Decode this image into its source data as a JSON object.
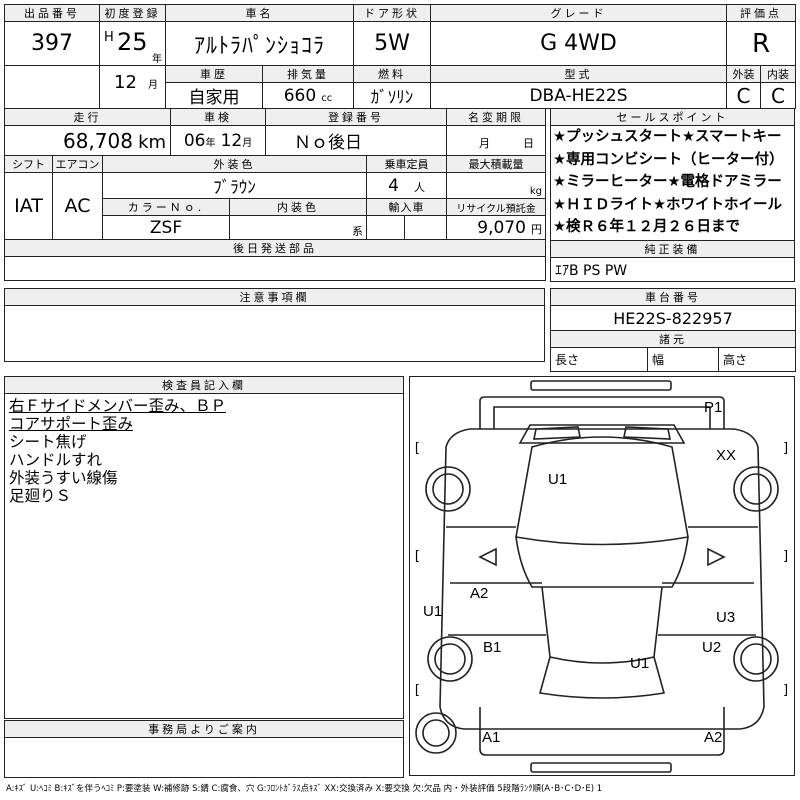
{
  "header": {
    "lot_label": "出品番号",
    "lot_number": "397",
    "first_reg_label": "初度登録",
    "era": "H",
    "year": "25",
    "year_unit": "年",
    "month": "12",
    "month_unit": "月",
    "car_name_label": "車名",
    "car_name": "ｱﾙﾄﾗﾊﾟﾝｼｮｺﾗ",
    "door_label": "ドア形状",
    "door": "5W",
    "grade_label": "グレード",
    "grade": "G 4WD",
    "score_label": "評価点",
    "score": "R",
    "history_label": "車歴",
    "history": "自家用",
    "displacement_label": "排気量",
    "displacement": "660",
    "displacement_unit": "cc",
    "fuel_label": "燃料",
    "fuel": "ｶﾞｿﾘﾝ",
    "model_label": "型式",
    "model": "DBA-HE22S",
    "exterior_label": "外装",
    "exterior": "C",
    "interior_label": "内装",
    "interior": "C"
  },
  "row2": {
    "mileage_label": "走行",
    "mileage": "68,708",
    "mileage_unit": "km",
    "inspection_label": "車検",
    "inspection_year": "06",
    "inspection_year_unit": "年",
    "inspection_month": "12",
    "inspection_month_unit": "月",
    "reg_number_label": "登録番号",
    "reg_number": "Ｎｏ後日",
    "name_change_label": "名変期限",
    "name_change_month": "月",
    "name_change_day": "日",
    "shift_label": "シフト",
    "shift": "IAT",
    "aircon_label": "エアコン",
    "aircon": "AC",
    "ext_color_label": "外装色",
    "ext_color": "ﾌﾞﾗｳﾝ",
    "capacity_label": "乗車定員",
    "capacity": "4",
    "capacity_unit": "人",
    "max_load_label": "最大積載量",
    "max_load_unit": "kg",
    "color_no_label": "カラーＮｏ.",
    "color_no": "ZSF",
    "int_color_label": "内装色",
    "int_color_unit": "系",
    "import_label": "輸入車",
    "recycle_label": "リサイクル預託金",
    "recycle": "9,070",
    "recycle_unit": "円",
    "later_parts_label": "後日発送部品"
  },
  "sales_points": {
    "label": "セールスポイント",
    "lines": [
      "★プッシュスタート★スマートキー",
      "★専用コンビシート（ヒーター付）",
      "★ミラーヒーター★電格ドアミラー",
      "★ＨＩＤライト★ホワイトホイール",
      "★検Ｒ６年１２月２６日まで"
    ]
  },
  "equipment": {
    "label": "純正装備",
    "value": "ｴｱB PS PW"
  },
  "notes": {
    "label": "注意事項欄"
  },
  "chassis": {
    "label": "車台番号",
    "value": "HE22S-822957"
  },
  "dimensions": {
    "label": "諸元",
    "length": "長さ",
    "width": "幅",
    "height": "高さ"
  },
  "inspector": {
    "label": "検査員記入欄",
    "lines": [
      "右Ｆサイドメンバー歪み、ＢＰ",
      "コアサポート歪み",
      "シート焦げ",
      "ハンドルすれ",
      "外装うすい線傷",
      "足廻りＳ"
    ]
  },
  "office": {
    "label": "事務局よりご案内"
  },
  "diagram": {
    "marks": {
      "p1": "P1",
      "xx": "XX",
      "u1_hood": "U1",
      "a2_left": "A2",
      "u1_left": "U1",
      "b1": "B1",
      "u3": "U3",
      "u2": "U2",
      "u1_rear": "U1",
      "a1": "A1",
      "a2_bottom": "A2"
    },
    "brackets": [
      "[",
      "]",
      "[",
      "]",
      "[",
      "]"
    ]
  },
  "legend": "A:ｷｽﾞ U:ﾍｺﾐ B:ｷｽﾞを伴うﾍｺﾐ P:要塗装 W:補修跡 S:錆 C:腐食、穴 G:ﾌﾛﾝﾄｶﾞﾗｽ点ｷｽﾞ XX:交換済み X:要交換 欠:欠品 内・外装評価 5段階ﾗﾝｸ順(A･B･C･D･E) 1"
}
